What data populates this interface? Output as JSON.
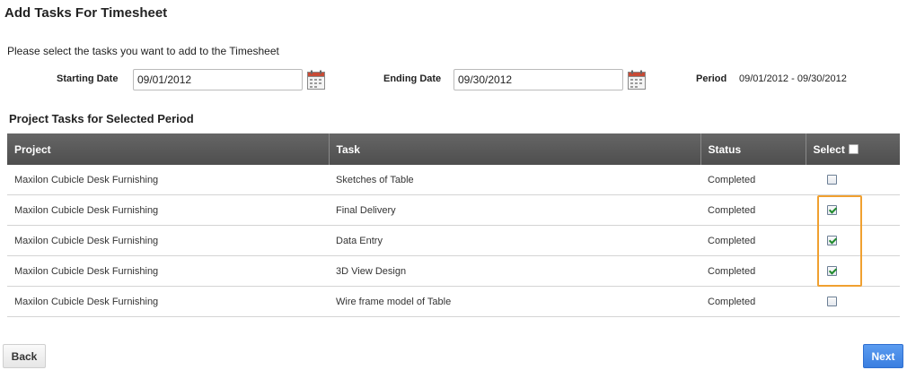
{
  "page": {
    "title": "Add Tasks For Timesheet",
    "instructions": "Please select the tasks you want to add to the Timesheet"
  },
  "filters": {
    "starting_date_label": "Starting Date",
    "starting_date_value": "09/01/2012",
    "ending_date_label": "Ending Date",
    "ending_date_value": "09/30/2012",
    "period_label": "Period",
    "period_value": "09/01/2012 - 09/30/2012",
    "calendar_icon": "calendar-icon"
  },
  "section_title": "Project Tasks for Selected Period",
  "table": {
    "headers": {
      "project": "Project",
      "task": "Task",
      "status": "Status",
      "select": "Select"
    },
    "select_all_checked": false,
    "rows": [
      {
        "project": "Maxilon Cubicle Desk Furnishing",
        "task": "Sketches of Table",
        "status": "Completed",
        "selected": false
      },
      {
        "project": "Maxilon Cubicle Desk Furnishing",
        "task": "Final Delivery",
        "status": "Completed",
        "selected": true
      },
      {
        "project": "Maxilon Cubicle Desk Furnishing",
        "task": "Data Entry",
        "status": "Completed",
        "selected": true
      },
      {
        "project": "Maxilon Cubicle Desk Furnishing",
        "task": "3D View Design",
        "status": "Completed",
        "selected": true
      },
      {
        "project": "Maxilon Cubicle Desk Furnishing",
        "task": "Wire frame model of Table",
        "status": "Completed",
        "selected": false
      }
    ]
  },
  "buttons": {
    "back": "Back",
    "next": "Next"
  },
  "colors": {
    "header_bg": "#555555",
    "highlight": "#f0a030",
    "next_button": "#3a7ee0",
    "checkmark": "#1f8a2c"
  }
}
